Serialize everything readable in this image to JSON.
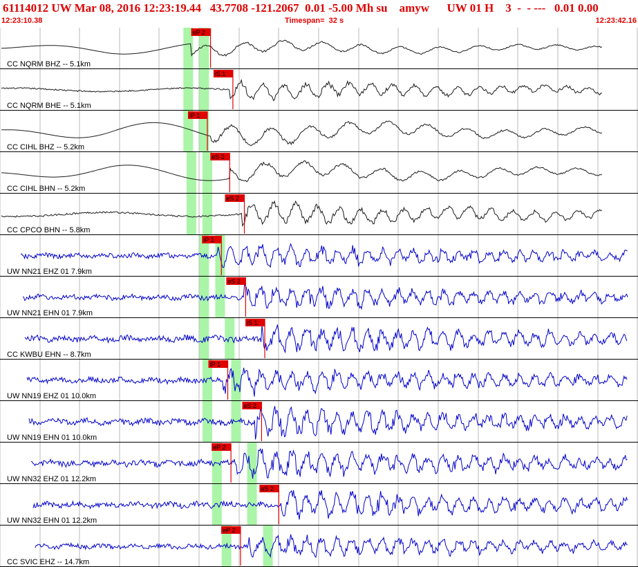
{
  "header": {
    "title": "61114012 UW Mar 08, 2016 12:23:19.44   43.7708 -121.2067  0.01 -5.00 Mh su    amyw      UW 01 H    3  -  - ---   0.01 0.00",
    "start_time": "12:23:10.38",
    "timespan": "Timespan=  32 s",
    "end_time": "12:23:42.16"
  },
  "colors": {
    "title_red": "#e00000",
    "pick_red": "#e00000",
    "pick_window_green": "#aaf5a8",
    "trace_black": "#1a1a1a",
    "trace_blue": "#0000c8",
    "grid_gray": "#b8b8b8"
  },
  "traces": [
    {
      "label": "CC NQRM BHZ -- 5.1km",
      "color": "black",
      "style": "lowfreq",
      "amp": 0.55,
      "onset": 0.3,
      "pick": {
        "label": "eP 2",
        "t": 0.33
      },
      "windows": [
        0.295,
        0.32
      ]
    },
    {
      "label": "CC NQRM BHE -- 5.1km",
      "color": "black",
      "style": "mixed",
      "amp": 0.6,
      "onset": 0.36,
      "pick": {
        "label": "iS 1",
        "t": 0.365
      },
      "windows": [
        0.295,
        0.32
      ]
    },
    {
      "label": "CC CIHL BHZ -- 5.2km",
      "color": "black",
      "style": "lowfreq",
      "amp": 0.85,
      "onset": 0.33,
      "pick": {
        "label": "iP 1",
        "t": 0.325
      },
      "windows": [
        0.295,
        0.32
      ]
    },
    {
      "label": "CC CIHL BHN -- 5.2km",
      "color": "black",
      "style": "lowfreq",
      "amp": 0.75,
      "onset": 0.36,
      "pick": {
        "label": "eS 2",
        "t": 0.36
      },
      "windows": [
        0.3,
        0.325
      ]
    },
    {
      "label": "CC CPCO BHN -- 5.8km",
      "color": "black",
      "style": "mixed",
      "amp": 0.75,
      "onset": 0.38,
      "pick": {
        "label": "eS 2",
        "t": 0.383
      },
      "windows": [
        0.3,
        0.325
      ]
    },
    {
      "label": "UW NN21 EHZ 01 7.9km",
      "color": "blue",
      "style": "hf",
      "amp": 0.7,
      "onset": 0.34,
      "pick": {
        "label": "iP 1",
        "t": 0.347
      },
      "windows": [
        0.32,
        0.345
      ]
    },
    {
      "label": "UW NN21 EHN 01 7.9km",
      "color": "blue",
      "style": "hf",
      "amp": 0.7,
      "onset": 0.38,
      "pick": {
        "label": "eS 2",
        "t": 0.385
      },
      "windows": [
        0.32,
        0.345
      ]
    },
    {
      "label": "CC KWBU EHN -- 8.7km",
      "color": "blue",
      "style": "hf",
      "amp": 0.85,
      "onset": 0.41,
      "pick": {
        "label": "iS 1",
        "t": 0.415
      },
      "windows": [
        0.32,
        0.36
      ]
    },
    {
      "label": "UW NN19 EHZ 01 10.0km",
      "color": "blue",
      "style": "hf",
      "amp": 0.75,
      "onset": 0.35,
      "pick": {
        "label": "iP 1",
        "t": 0.357
      },
      "windows": [
        0.325,
        0.37
      ]
    },
    {
      "label": "UW NN19 EHN 01 10.0km",
      "color": "blue",
      "style": "hf",
      "amp": 0.85,
      "onset": 0.4,
      "pick": {
        "label": "eS 2",
        "t": 0.41
      },
      "windows": [
        0.325,
        0.37
      ]
    },
    {
      "label": "UW NN32 EHZ 01 12.2km",
      "color": "blue",
      "style": "hf",
      "amp": 0.85,
      "onset": 0.37,
      "pick": {
        "label": "eP 2",
        "t": 0.362
      },
      "windows": [
        0.34,
        0.395
      ]
    },
    {
      "label": "UW NN32 EHN 01 12.2km",
      "color": "blue",
      "style": "hf",
      "amp": 0.8,
      "onset": 0.44,
      "pick": {
        "label": "eS 2",
        "t": 0.437
      },
      "windows": [
        0.34,
        0.395
      ]
    },
    {
      "label": "CC SVIC EHZ -- 14.7km",
      "color": "blue",
      "style": "hf",
      "amp": 0.65,
      "onset": 0.39,
      "pick": {
        "label": "eP 2",
        "t": 0.377
      },
      "windows": [
        0.355,
        0.42
      ]
    }
  ]
}
